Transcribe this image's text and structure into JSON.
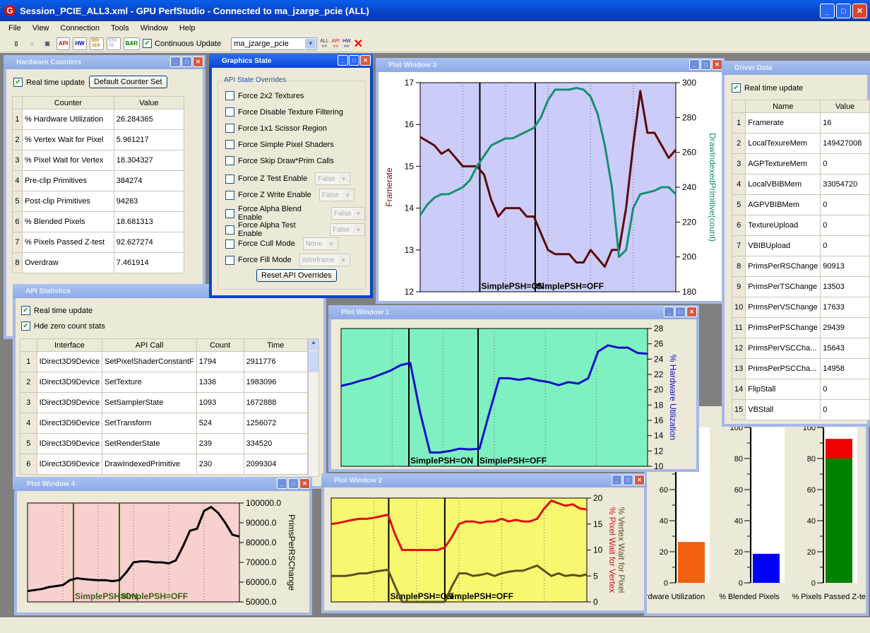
{
  "app": {
    "title": "Session_PCIE_ALL3.xml - GPU PerfStudio - Connected to ma_jzarge_pcie (ALL)",
    "logo": "G"
  },
  "menu": [
    "File",
    "View",
    "Connection",
    "Tools",
    "Window",
    "Help"
  ],
  "toolbar": {
    "buttons": [
      "API",
      "HW",
      "DRI VER",
      "STA TE",
      "BAR"
    ],
    "continuous_update": "Continuous Update",
    "continuous_checked": true,
    "connection": "ma_jzarge_pcie",
    "icons": [
      "new-icon",
      "open-icon",
      "save-icon",
      "run-all-icon",
      "run-api-icon",
      "run-hw-icon",
      "stop-icon"
    ],
    "run_labels": [
      "ALL",
      "API",
      "HW"
    ]
  },
  "hw_counters": {
    "title": "Hardware Counters",
    "realtime": "Real time update",
    "default_btn": "Default Counter Set",
    "columns": [
      "Counter",
      "Value"
    ],
    "rows": [
      [
        "1",
        "% Hardware Utilization",
        "26.284365"
      ],
      [
        "2",
        "% Vertex Wait for Pixel",
        "5.961217"
      ],
      [
        "3",
        "% Pixel Wait for Vertex",
        "18.304327"
      ],
      [
        "4",
        "Pre-clip Primitives",
        "384274"
      ],
      [
        "5",
        "Post-clip Primitives",
        "94263"
      ],
      [
        "6",
        "% Blended Pixels",
        "18.681313"
      ],
      [
        "7",
        "% Pixels Passed Z-test",
        "92.627274"
      ],
      [
        "8",
        "Overdraw",
        "7.461914"
      ]
    ]
  },
  "graphics_state": {
    "title": "Graphics State",
    "group": "API State Overrides",
    "options": [
      {
        "label": "Force 2x2 Textures"
      },
      {
        "label": "Force Disable Texture Filtering"
      },
      {
        "label": "Force 1x1 Scissor Region"
      },
      {
        "label": "Force Simple Pixel Shaders"
      },
      {
        "label": "Force Skip Draw*Prim Calls"
      },
      {
        "label": "Force Z Test Enable",
        "value": "False"
      },
      {
        "label": "Force Z Write Enable",
        "value": "False"
      },
      {
        "label": "Force Alpha Blend Enable",
        "value": "False"
      },
      {
        "label": "Force Alpha Test Enable",
        "value": "False"
      },
      {
        "label": "Force Cull Mode",
        "value": "None"
      },
      {
        "label": "Force Fill Mode",
        "value": "Wireframe"
      }
    ],
    "reset": "Reset API Overrides"
  },
  "api_stats": {
    "title": "API Statistics",
    "realtime": "Real time update",
    "hide_zero": "Hde zero count stats",
    "columns": [
      "Interface",
      "API Call",
      "Count",
      "Time"
    ],
    "rows": [
      [
        "1",
        "IDirect3D9Device",
        "SetPixelShaderConstantF",
        "1794",
        "2911776"
      ],
      [
        "2",
        "IDirect3D9Device",
        "SetTexture",
        "1336",
        "1983096"
      ],
      [
        "3",
        "IDirect3D9Device",
        "SetSamplerState",
        "1093",
        "1672888"
      ],
      [
        "4",
        "IDirect3D9Device",
        "SetTransform",
        "524",
        "1256072"
      ],
      [
        "5",
        "IDirect3D9Device",
        "SetRenderState",
        "239",
        "334520"
      ],
      [
        "6",
        "IDirect3D9Device",
        "DrawIndexedPrimitive",
        "230",
        "2099304"
      ]
    ]
  },
  "driver_data": {
    "title": "Driver Data",
    "realtime": "Real time update",
    "columns": [
      "Name",
      "Value"
    ],
    "rows": [
      [
        "1",
        "Framerate",
        "16"
      ],
      [
        "2",
        "LocalTexureMem",
        "149427008"
      ],
      [
        "3",
        "AGPTextureMem",
        "0"
      ],
      [
        "4",
        "LocalVBIBMem",
        "33054720"
      ],
      [
        "5",
        "AGPVBIBMem",
        "0"
      ],
      [
        "6",
        "TextureUpload",
        "0"
      ],
      [
        "7",
        "VBIBUpload",
        "0"
      ],
      [
        "8",
        "PrimsPerRSChange",
        "90913"
      ],
      [
        "9",
        "PrimsPerTSChange",
        "13503"
      ],
      [
        "10",
        "PrimsPerVSChange",
        "17633"
      ],
      [
        "11",
        "PrimsPerPSChange",
        "29439"
      ],
      [
        "12",
        "PrimsPerVSCCha...",
        "15643"
      ],
      [
        "13",
        "PrimsPerPSCCha...",
        "14958"
      ],
      [
        "14",
        "FlipStall",
        "0"
      ],
      [
        "15",
        "VBStall",
        "0"
      ]
    ]
  },
  "plot_titles": {
    "p3": "Plot Window 3",
    "p1": "Plot Window 1",
    "p4": "Plot Window 4",
    "p2": "Plot Window 2"
  },
  "chart_data": [
    {
      "id": "p3",
      "type": "line",
      "background": "#ccccf8",
      "grid": true,
      "axes": {
        "left": {
          "label": "Framerate",
          "range": [
            12,
            17
          ],
          "ticks": [
            12,
            13,
            14,
            15,
            16,
            17
          ],
          "color": "#6b1010"
        },
        "right": {
          "label": "DrawIndexedPrimitive(count)",
          "range": [
            180,
            300
          ],
          "ticks": [
            180,
            200,
            220,
            240,
            260,
            280,
            300
          ],
          "color": "#159070"
        }
      },
      "markers": [
        {
          "x": 8.4,
          "label": "SimplePSH=ON"
        },
        {
          "x": 16.2,
          "label": "SimplePSH=OFF"
        }
      ],
      "series": [
        {
          "name": "Framerate",
          "axis": "left",
          "color": "#5a0a0a",
          "values": [
            15.7,
            15.6,
            15.5,
            15.3,
            15.4,
            15.2,
            15.0,
            15.0,
            15.0,
            14.8,
            14.2,
            13.8,
            14.0,
            14.0,
            14.0,
            13.8,
            13.8,
            13.4,
            13.0,
            12.9,
            12.9,
            12.9,
            12.7,
            12.7,
            13.0,
            12.8,
            12.6,
            13.0,
            13.0,
            14.0,
            15.5,
            16.8,
            15.8,
            15.8,
            15.5,
            15.2,
            15.4
          ]
        },
        {
          "name": "DrawIndexedPrimitive(count)",
          "axis": "right",
          "color": "#159070",
          "values": [
            224,
            230,
            234,
            236,
            236,
            238,
            240,
            244,
            252,
            258,
            264,
            266,
            268,
            268,
            270,
            272,
            274,
            280,
            290,
            296,
            296,
            296,
            297,
            296,
            292,
            282,
            264,
            240,
            200,
            204,
            228,
            236,
            237,
            238,
            240,
            240,
            236
          ]
        }
      ]
    },
    {
      "id": "p1",
      "type": "line",
      "background": "#7ff0c0",
      "grid": true,
      "axes": {
        "right": {
          "label": "% Hardware Utilization",
          "range": [
            10,
            28
          ],
          "ticks": [
            10,
            12,
            14,
            16,
            18,
            20,
            22,
            24,
            26,
            28
          ],
          "color": "#1010c0"
        }
      },
      "markers": [
        {
          "x": 6.86,
          "label": "SimplePSH=ON"
        },
        {
          "x": 13.86,
          "label": "SimplePSH=OFF"
        }
      ],
      "series": [
        {
          "name": "% Hardware Utilization",
          "axis": "right",
          "color": "#1010c8",
          "values": [
            20.5,
            20.8,
            21.2,
            21.5,
            22,
            22.5,
            23.2,
            23.5,
            17,
            11.8,
            11.8,
            12,
            12.3,
            12.2,
            12.3,
            17,
            21.5,
            21.5,
            21.3,
            21.5,
            21.2,
            21,
            20.6,
            21,
            20.8,
            21.5,
            25,
            25.8,
            25.5,
            25.5,
            24.8,
            24.7
          ]
        }
      ]
    },
    {
      "id": "p4",
      "type": "line",
      "background": "#f8d0d0",
      "grid": true,
      "axes": {
        "right": {
          "label": "PrimsPerRSChange",
          "range": [
            50000,
            100000
          ],
          "ticks": [
            50000,
            60000,
            70000,
            80000,
            90000,
            100000
          ],
          "tick_format": "0.0",
          "color": "#000000"
        }
      },
      "markers": [
        {
          "x": 6.5,
          "label": "SimplePSH=ON"
        },
        {
          "x": 13,
          "label": "SimplePSH=OFF"
        }
      ],
      "marker_color": "#3a6010",
      "series": [
        {
          "name": "PrimsPerRSChange",
          "axis": "right",
          "color": "#000000",
          "values": [
            55500,
            56000,
            56500,
            57500,
            58000,
            58500,
            61000,
            62000,
            61500,
            61200,
            61000,
            61000,
            60500,
            61000,
            65000,
            70000,
            70500,
            70500,
            70000,
            70000,
            69500,
            71000,
            78000,
            86000,
            87000,
            96000,
            98000,
            95000,
            90000,
            84000,
            83000
          ]
        }
      ]
    },
    {
      "id": "p2",
      "type": "line",
      "background": "#f8f870",
      "grid": true,
      "axes": {
        "right": {
          "label": "% Pixel Wait for Vertex",
          "label2": "% Vertex Wait for Pixel",
          "range": [
            0,
            20
          ],
          "ticks": [
            0,
            5,
            10,
            15,
            20
          ],
          "color": "#e01010",
          "color2": "#605020"
        }
      },
      "markers": [
        {
          "x": 8.1,
          "label": "SimplePSH=ON"
        },
        {
          "x": 16,
          "label": "SimplePSH=OFF"
        }
      ],
      "series": [
        {
          "name": "% Pixel Wait for Vertex",
          "axis": "right",
          "color": "#e01010",
          "values": [
            15,
            15.2,
            15.5,
            15.8,
            16,
            16,
            16.2,
            16.5,
            16.8,
            13,
            10,
            10,
            10,
            10,
            10,
            10,
            10.5,
            12.5,
            15,
            15.5,
            15.5,
            15.2,
            15.5,
            15.5,
            16,
            15.5,
            15.8,
            15.5,
            15.5,
            16,
            18,
            19.5,
            19,
            18.5,
            18.8,
            18,
            17.8
          ]
        },
        {
          "name": "% Vertex Wait for Pixel",
          "axis": "right",
          "color": "#5a5020",
          "values": [
            5,
            5,
            5,
            5.2,
            5.5,
            5.5,
            5.8,
            6,
            6.2,
            3,
            0,
            0,
            0,
            0,
            0,
            0,
            0,
            3,
            5.5,
            5.5,
            5,
            5.2,
            5.5,
            5,
            5.5,
            5.8,
            6,
            6,
            6.5,
            7,
            6,
            5,
            5.5,
            5,
            5.2,
            5,
            5.3
          ]
        }
      ]
    },
    {
      "id": "bars",
      "type": "bar",
      "ylim": [
        0,
        100
      ],
      "ticks": [
        0,
        20,
        40,
        60,
        80,
        100
      ],
      "categories": [
        "Hardware Utilization",
        "% Blended Pixels",
        "% Pixels Passed Z-test"
      ],
      "values": [
        26.284365,
        18.681313,
        92.627274
      ],
      "colors": [
        "#f06010",
        "#0000f8",
        "#008000"
      ],
      "overflow_color": "#f00000",
      "overflow_threshold": 80
    }
  ]
}
